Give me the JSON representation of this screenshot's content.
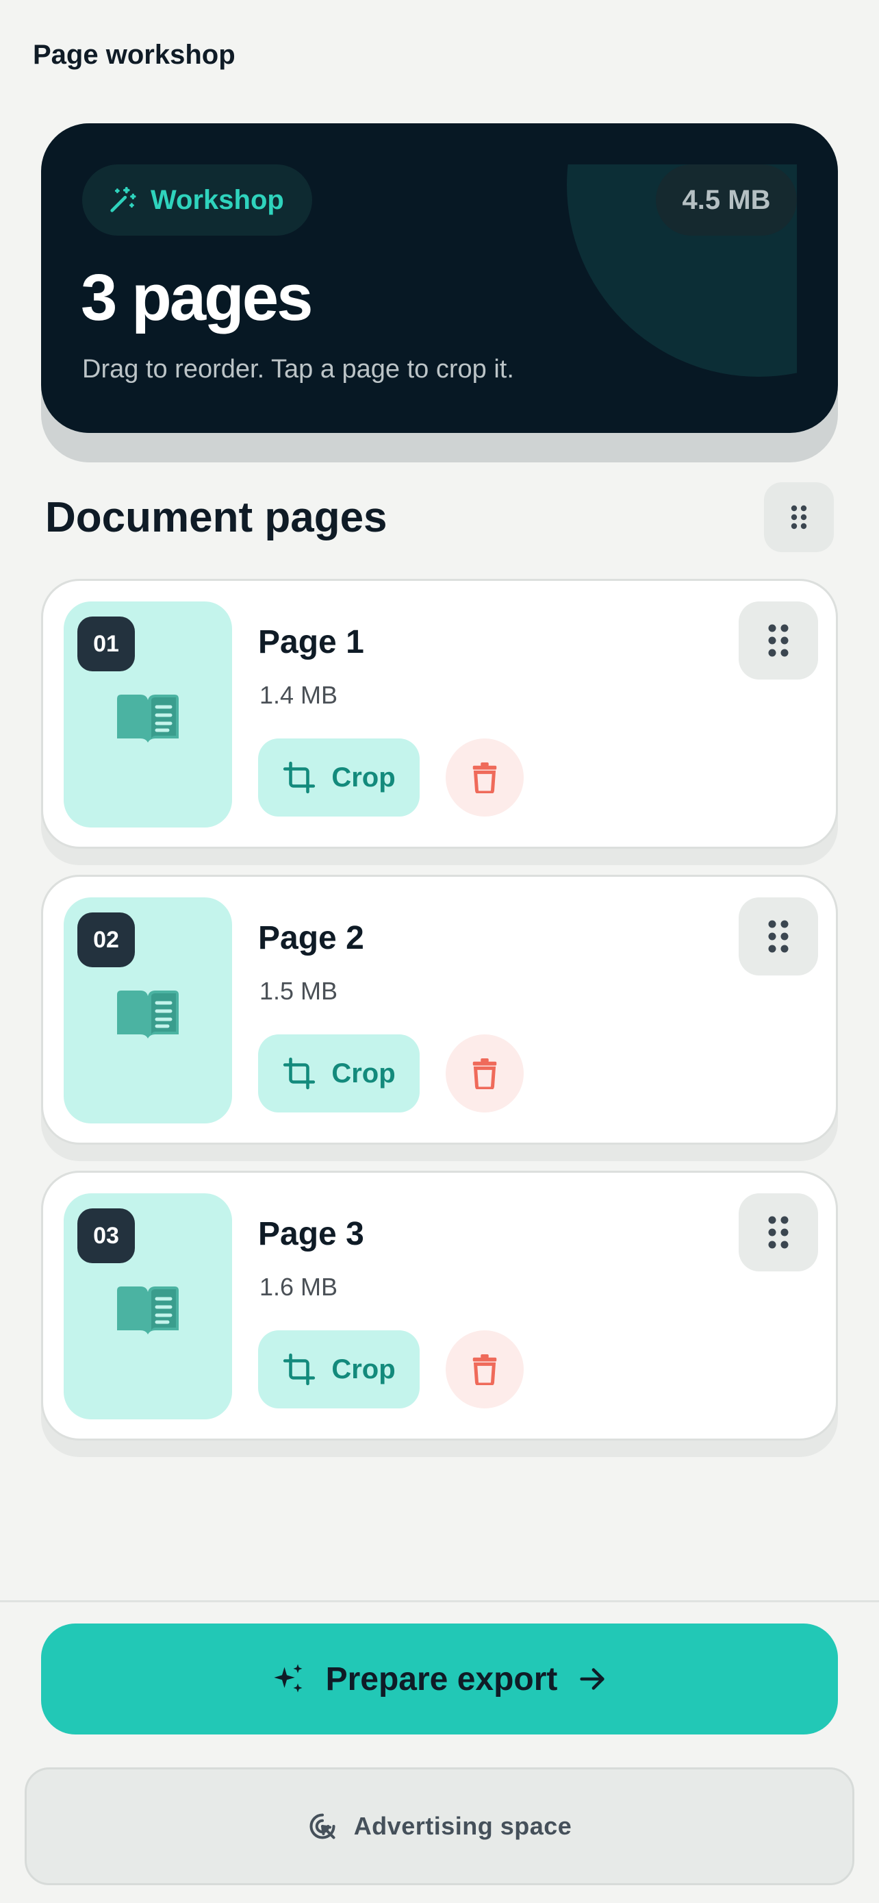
{
  "app": {
    "title": "Page workshop"
  },
  "hero": {
    "chip_label": "Workshop",
    "chip_icon": "magic-wand-icon",
    "total_size": "4.5 MB",
    "page_count": "3 pages",
    "subtitle": "Drag to reorder. Tap a page to crop it."
  },
  "section": {
    "title": "Document pages",
    "action_icon": "grid-dots-icon"
  },
  "pages": [
    {
      "number": "01",
      "name": "Page 1",
      "size": "1.4 MB",
      "crop_label": "Crop"
    },
    {
      "number": "02",
      "name": "Page 2",
      "size": "1.5 MB",
      "crop_label": "Crop"
    },
    {
      "number": "03",
      "name": "Page 3",
      "size": "1.6 MB",
      "crop_label": "Crop"
    }
  ],
  "footer": {
    "export_label": "Prepare export",
    "ad_label": "Advertising space"
  },
  "colors": {
    "accent": "#22c8b6",
    "hero_bg": "#071824",
    "thumb_bg": "#c4f4ec",
    "delete_red": "#ef6a5a"
  }
}
